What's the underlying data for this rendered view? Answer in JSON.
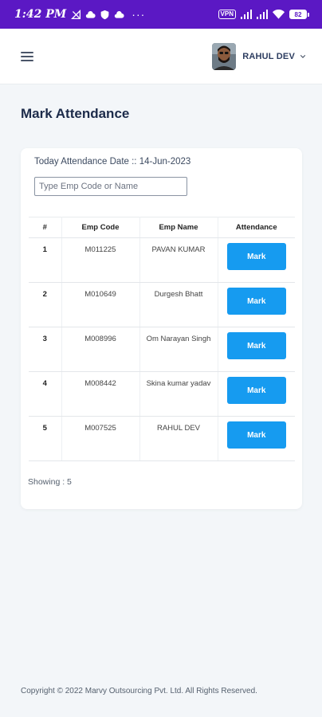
{
  "status_bar": {
    "time": "1:42 PM",
    "more": "···",
    "vpn": "VPN",
    "battery": "82",
    "icons": [
      "signal-off-icon",
      "cloud-icon",
      "shield-icon",
      "cloud-icon",
      "vpn-icon",
      "signal-icon",
      "signal-icon",
      "wifi-icon",
      "battery-icon"
    ]
  },
  "header": {
    "user_name": "RAHUL DEV",
    "menu_icon": "hamburger-icon",
    "dropdown_icon": "chevron-down-icon"
  },
  "page": {
    "title": "Mark Attendance"
  },
  "attendance": {
    "date_label": "Today Attendance Date :: 14-Jun-2023",
    "search_placeholder": "Type Emp Code or Name",
    "columns": [
      "#",
      "Emp Code",
      "Emp Name",
      "Attendance"
    ],
    "rows": [
      {
        "no": "1",
        "code": "M011225",
        "name": "PAVAN KUMAR",
        "action": "Mark"
      },
      {
        "no": "2",
        "code": "M010649",
        "name": "Durgesh Bhatt",
        "action": "Mark"
      },
      {
        "no": "3",
        "code": "M008996",
        "name": "Om Narayan Singh",
        "action": "Mark"
      },
      {
        "no": "4",
        "code": "M008442",
        "name": "Skina kumar yadav",
        "action": "Mark"
      },
      {
        "no": "5",
        "code": "M007525",
        "name": "RAHUL DEV",
        "action": "Mark"
      }
    ],
    "showing": "Showing : 5"
  },
  "footer": {
    "text": "Copyright © 2022 Marvy Outsourcing Pvt. Ltd. All Rights Reserved."
  },
  "colors": {
    "status_bar": "#5b18c4",
    "accent_button": "#169bf0",
    "page_bg": "#f3f6f9"
  }
}
